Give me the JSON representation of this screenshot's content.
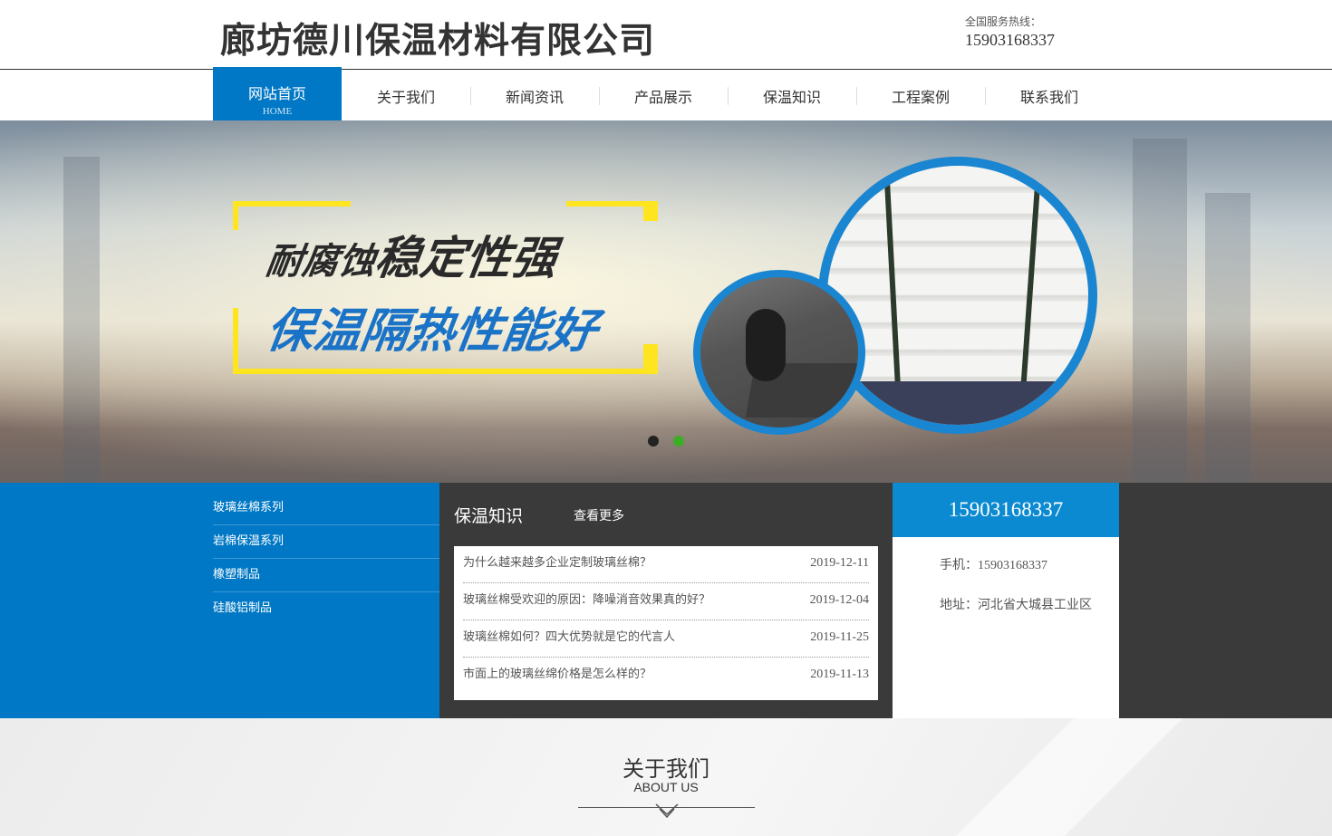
{
  "header": {
    "company_name": "廊坊德川保温材料有限公司",
    "hotline_label": "全国服务热线：",
    "hotline_number": "15903168337"
  },
  "nav": {
    "items": [
      {
        "label": "网站首页",
        "sub": "HOME"
      },
      {
        "label": "关于我们"
      },
      {
        "label": "新闻资讯"
      },
      {
        "label": "产品展示"
      },
      {
        "label": "保温知识"
      },
      {
        "label": "工程案例"
      },
      {
        "label": "联系我们"
      }
    ],
    "active_index": 0
  },
  "banner": {
    "slogan_line1_small": "耐腐蚀",
    "slogan_line1_big": "稳定性强",
    "slogan_line2": "保温隔热性能好",
    "active_slide": 2,
    "slide_count": 2
  },
  "categories": [
    "玻璃丝棉系列",
    "岩棉保温系列",
    "橡塑制品",
    "硅酸铝制品"
  ],
  "news": {
    "title": "保温知识",
    "more": "查看更多",
    "items": [
      {
        "title": "为什么越来越多企业定制玻璃丝棉？",
        "date": "2019-12-11"
      },
      {
        "title": "玻璃丝棉受欢迎的原因：降噪消音效果真的好？",
        "date": "2019-12-04"
      },
      {
        "title": "玻璃丝棉如何？四大优势就是它的代言人",
        "date": "2019-11-25"
      },
      {
        "title": "市面上的玻璃丝绵价格是怎么样的？",
        "date": "2019-11-13"
      }
    ]
  },
  "contact": {
    "phone_big": "15903168337",
    "mobile": "手机：15903168337",
    "address": "地址：河北省大城县工业区"
  },
  "about": {
    "title": "关于我们",
    "subtitle": "ABOUT US"
  },
  "colors": {
    "brand_blue": "#0078c5",
    "dark_panel": "#3a3a3a",
    "slogan_blue": "#1a73c7",
    "frame_yellow": "#ffe51f",
    "active_dot": "#3cae26"
  }
}
